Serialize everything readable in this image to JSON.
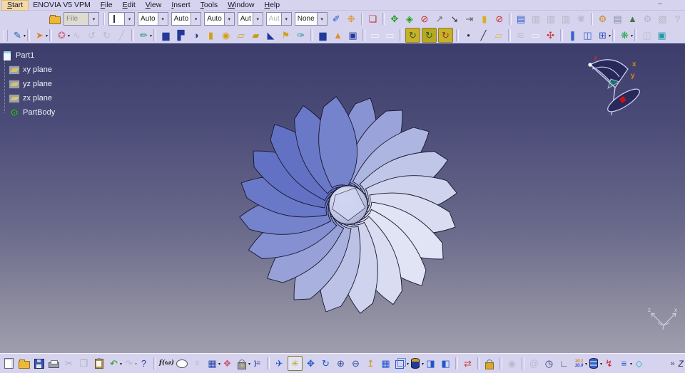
{
  "menu": {
    "items": [
      {
        "label": "Start",
        "ul": true,
        "hl": true
      },
      {
        "label": "ENOVIA V5 VPM",
        "ul": false
      },
      {
        "label": "File",
        "ul": true
      },
      {
        "label": "Edit",
        "ul": true
      },
      {
        "label": "View",
        "ul": true
      },
      {
        "label": "Insert",
        "ul": true
      },
      {
        "label": "Tools",
        "ul": true
      },
      {
        "label": "Window",
        "ul": true
      },
      {
        "label": "Help",
        "ul": true
      }
    ],
    "minimize_glyph": "–"
  },
  "filter_toolbar": {
    "file_combo": {
      "value": "File",
      "disabled": true
    },
    "swatch_color": "#1e8a1e",
    "combos": [
      {
        "value": "Auto"
      },
      {
        "value": "Auto"
      },
      {
        "value": "Auto"
      },
      {
        "value": "Aut",
        "narrow": true
      },
      {
        "value": "Aut",
        "narrow": true,
        "lite": true
      },
      {
        "value": "None"
      }
    ]
  },
  "toolbar2_icons": [
    {
      "n": "open-folder-icon",
      "s": "folder"
    },
    {
      "t": "combo-file"
    },
    {
      "t": "sep"
    },
    {
      "t": "combo-swatch"
    },
    {
      "t": "combos"
    },
    {
      "n": "painter-icon",
      "g": "✐",
      "c": "#2a55c8"
    },
    {
      "n": "paint-ball-icon",
      "g": "❉",
      "c": "#e09020"
    },
    {
      "t": "sep"
    },
    {
      "n": "image-capture-icon",
      "g": "❏",
      "c": "#c03333"
    },
    {
      "t": "sep"
    },
    {
      "n": "move-element-icon",
      "g": "✥",
      "c": "#1f9f1f"
    },
    {
      "n": "snap-element-icon",
      "g": "◈",
      "c": "#1f9f1f"
    },
    {
      "n": "axis-lock-icon",
      "g": "⊘",
      "c": "#cc2222"
    },
    {
      "n": "ray-pointer-icon",
      "g": "↗",
      "c": "#707070"
    },
    {
      "n": "target-arrow-icon",
      "g": "↘",
      "c": "#303030"
    },
    {
      "n": "step-snap-icon",
      "g": "⇥",
      "c": "#606060"
    },
    {
      "n": "ruler-cursor-icon",
      "g": "▮",
      "c": "#d8b020"
    },
    {
      "n": "no-magnify-icon",
      "g": "⊘",
      "c": "#cc2222"
    },
    {
      "t": "sep"
    },
    {
      "n": "form-sheet-icon",
      "g": "▤",
      "c": "#2a55c8"
    },
    {
      "n": "vpm-table-icon-1",
      "g": "▥",
      "c": "#888",
      "d": 1
    },
    {
      "n": "vpm-table-icon-2",
      "g": "▥",
      "c": "#888",
      "d": 1
    },
    {
      "n": "vpm-table-icon-3",
      "g": "▥",
      "c": "#888",
      "d": 1
    },
    {
      "n": "vpm-flower-icon",
      "g": "❋",
      "c": "#888",
      "d": 1
    },
    {
      "t": "sep"
    },
    {
      "n": "gear-transfer-icon",
      "g": "⚙",
      "c": "#cc8820"
    },
    {
      "n": "sheet-icon",
      "g": "▤",
      "c": "#8890a8"
    },
    {
      "n": "image-mountain-icon",
      "g": "▲",
      "c": "#447744"
    },
    {
      "n": "gear-gray-icon",
      "g": "⚙",
      "c": "#888",
      "d": 1
    },
    {
      "n": "transfer-gray-icon",
      "g": "▧",
      "c": "#888",
      "d": 1
    },
    {
      "n": "help-gray-icon",
      "g": "?",
      "c": "#888",
      "d": 1
    }
  ],
  "toolbar3_icons": [
    {
      "n": "sketcher-icon",
      "g": "✎",
      "c": "#2266aa",
      "dd": 1
    },
    {
      "t": "sep"
    },
    {
      "n": "select-cursor-icon",
      "g": "➤",
      "c": "#e08030",
      "dd": 1
    },
    {
      "t": "sep"
    },
    {
      "n": "people-icon",
      "g": "✪",
      "c": "#cc7788",
      "dd": 1
    },
    {
      "n": "wave-gray-icon",
      "g": "∿",
      "c": "#999",
      "d": 1
    },
    {
      "n": "rotate-left-gray-icon",
      "g": "↺",
      "c": "#999",
      "d": 1
    },
    {
      "n": "rotate-right-gray-icon",
      "g": "↻",
      "c": "#999",
      "d": 1
    },
    {
      "n": "slash-gray-icon",
      "g": "╱",
      "c": "#999",
      "d": 1
    },
    {
      "t": "sep"
    },
    {
      "n": "workbench-icon",
      "g": "✏",
      "c": "#1f8f8f",
      "dd": 1
    },
    {
      "t": "sep"
    },
    {
      "n": "pad-icon",
      "g": "▆",
      "c": "#22399a"
    },
    {
      "n": "pocket-icon",
      "g": "▛",
      "c": "#22399a"
    },
    {
      "n": "shaft-icon",
      "g": "◑",
      "c": "#22399a"
    },
    {
      "n": "groove-icon",
      "g": "▮",
      "c": "#d4a017"
    },
    {
      "n": "hole-icon",
      "g": "◉",
      "c": "#d4a017"
    },
    {
      "n": "rib-icon",
      "g": "▱",
      "c": "#d4a017"
    },
    {
      "n": "slot-icon",
      "g": "▰",
      "c": "#c89a10"
    },
    {
      "n": "stiffener-icon",
      "g": "◣",
      "c": "#22399a"
    },
    {
      "n": "loft-icon",
      "g": "⚑",
      "c": "#d4a017"
    },
    {
      "n": "surface-pencil-icon",
      "g": "✑",
      "c": "#1f8f8f"
    },
    {
      "t": "sep"
    },
    {
      "n": "pad-second-icon",
      "g": "▆",
      "c": "#22399a"
    },
    {
      "n": "bell-icon",
      "g": "▲",
      "c": "#e09020"
    },
    {
      "n": "block-icon",
      "g": "▣",
      "c": "#22399a"
    },
    {
      "t": "sep"
    },
    {
      "n": "constraint-oval-icon-1",
      "g": "▭",
      "c": "#f4f4fc"
    },
    {
      "n": "constraint-oval-icon-2",
      "g": "▭",
      "c": "#f4f4fc"
    },
    {
      "t": "sep"
    },
    {
      "n": "boolean-assemble-icon",
      "g": "↻",
      "c": "#226622",
      "bg": "#c8b028"
    },
    {
      "n": "boolean-add-icon",
      "g": "↻",
      "c": "#226622",
      "bg": "#b8a820"
    },
    {
      "n": "boolean-remove-icon",
      "g": "↻",
      "c": "#884422",
      "bg": "#c8b028"
    },
    {
      "t": "sep"
    },
    {
      "n": "point-icon",
      "g": "•",
      "c": "#333344"
    },
    {
      "n": "line-icon",
      "g": "╱",
      "c": "#333344"
    },
    {
      "n": "plane-icon",
      "g": "▱",
      "c": "#d8c040"
    },
    {
      "t": "sep"
    },
    {
      "n": "surface-gray-icon",
      "g": "≋",
      "c": "#999",
      "d": 1
    },
    {
      "n": "join-icon",
      "g": "▭",
      "c": "#f0f0f8"
    },
    {
      "n": "stamp-icon",
      "g": "✣",
      "c": "#cc3333"
    },
    {
      "t": "sep"
    },
    {
      "n": "catalog-icon",
      "g": "❚",
      "c": "#3366cc"
    },
    {
      "n": "mannequin-icon",
      "g": "◫",
      "c": "#3366cc"
    },
    {
      "n": "pattern-grid-icon",
      "g": "⊞",
      "c": "#3355bb",
      "dd": 1
    },
    {
      "t": "sep"
    },
    {
      "n": "axis-system-icon",
      "g": "❋",
      "c": "#22aa44",
      "dd": 1
    },
    {
      "t": "sep"
    },
    {
      "n": "measure-gray-icon",
      "g": "◫",
      "c": "#999",
      "d": 1
    },
    {
      "n": "bounding-box-icon",
      "g": "▣",
      "c": "#2299aa"
    }
  ],
  "bottom_icons": [
    {
      "n": "new-icon",
      "s": "page"
    },
    {
      "n": "open-icon",
      "s": "folder"
    },
    {
      "n": "save-icon",
      "s": "floppy"
    },
    {
      "n": "print-icon",
      "s": "printer"
    },
    {
      "n": "cut-icon",
      "g": "✂",
      "c": "#777",
      "d": 1
    },
    {
      "n": "copy-icon",
      "g": "❐",
      "c": "#777",
      "d": 1
    },
    {
      "n": "paste-icon",
      "s": "clipboard"
    },
    {
      "n": "undo-icon",
      "g": "↶",
      "c": "#22991f",
      "dd": 1
    },
    {
      "n": "redo-icon",
      "g": "↷",
      "c": "#999",
      "d": 1,
      "dd": 1
    },
    {
      "n": "help-what-icon",
      "g": "?",
      "c": "#2244aa"
    },
    {
      "t": "sep"
    },
    {
      "n": "formula-icon",
      "g": "f(ω)",
      "c": "#222",
      "small": 1,
      "italic": 1
    },
    {
      "n": "comment-bubble-icon",
      "s": "bubble"
    },
    {
      "n": "tiny-gray-icon",
      "g": "8",
      "c": "#aaa",
      "d": 1,
      "small": 1
    },
    {
      "n": "design-table-icon",
      "g": "▦",
      "c": "#2244aa",
      "dd": 1
    },
    {
      "n": "product-structure-icon",
      "g": "❖",
      "c": "#cc5577"
    },
    {
      "n": "lock-icon",
      "s": "lock",
      "dd": 1
    },
    {
      "n": "relations-icon",
      "g": "}=",
      "c": "#2244aa",
      "small": 1
    },
    {
      "t": "sep"
    },
    {
      "n": "fly-mode-icon",
      "g": "✈",
      "c": "#2255cc"
    },
    {
      "n": "fit-all-icon",
      "g": "✳",
      "c": "#c8a020",
      "bg": "#e2e5f4"
    },
    {
      "n": "pan-icon",
      "g": "✥",
      "c": "#2255cc"
    },
    {
      "n": "rotate-view-icon",
      "g": "↻",
      "c": "#2255cc"
    },
    {
      "n": "zoom-in-icon",
      "g": "⊕",
      "c": "#2f4f9f"
    },
    {
      "n": "zoom-out-icon",
      "g": "⊖",
      "c": "#2f4f9f"
    },
    {
      "n": "normal-view-icon",
      "g": "↥",
      "c": "#cc9922"
    },
    {
      "n": "multi-view-icon",
      "g": "▦",
      "c": "#2255cc"
    },
    {
      "n": "iso-view-icon",
      "s": "cube",
      "dd": 1
    },
    {
      "n": "shading-icon",
      "s": "cyl",
      "dd": 1
    },
    {
      "n": "hide-show-icon",
      "g": "◨",
      "c": "#2255cc"
    },
    {
      "n": "swap-visible-icon",
      "g": "◧",
      "c": "#2255cc"
    },
    {
      "t": "sep"
    },
    {
      "n": "swap-space-icon",
      "g": "⇄",
      "c": "#cc4433"
    },
    {
      "t": "sep"
    },
    {
      "n": "data-lock-icon",
      "s": "lockgold"
    },
    {
      "t": "sep"
    },
    {
      "n": "camera-icon",
      "g": "◉",
      "c": "#999",
      "d": 1
    },
    {
      "t": "sep"
    },
    {
      "n": "spiral-gray-icon",
      "g": "@",
      "c": "#999",
      "d": 1
    },
    {
      "n": "knowledge-clock-icon",
      "g": "◷",
      "c": "#223366"
    },
    {
      "n": "axes-corner-icon",
      "g": "∟",
      "c": "#445566"
    },
    {
      "n": "measure-between-icon",
      "s": "nums",
      "dd": 1
    },
    {
      "n": "mass-properties-icon",
      "s": "cylblue",
      "dd": 1
    },
    {
      "n": "spark-icon",
      "g": "↯",
      "c": "#cc2222"
    },
    {
      "n": "list-icon",
      "g": "≡",
      "c": "#2255cc",
      "dd": 1
    },
    {
      "n": "free-diamond-icon",
      "g": "◇",
      "c": "#22aacc"
    }
  ],
  "measure_icon_text": {
    "top": "10.1",
    "bottom": "10.0"
  },
  "bottom_right": {
    "overflow_glyph": "»",
    "partial_icon_glyph": "Z"
  },
  "tree": {
    "root": {
      "label": "Part1",
      "icon": "doc"
    },
    "items": [
      {
        "label": "xy plane",
        "icon": "plane"
      },
      {
        "label": "yz plane",
        "icon": "plane"
      },
      {
        "label": "zx plane",
        "icon": "plane"
      },
      {
        "label": "PartBody",
        "icon": "gear"
      }
    ]
  },
  "compass": {
    "z": "z",
    "x": "x",
    "y": "y",
    "label_color_z": "#c03030",
    "label_color_xy": "#d88818",
    "outline_color": "#ccccee",
    "fill_color": "#28285a",
    "wedge_color": "#1f6f6f",
    "square_color": "#cc1111"
  },
  "triad": {
    "z": "z",
    "x": "x",
    "color": "#d0d0e2"
  },
  "model": {
    "kind": "impeller-fan",
    "blade_count": 20,
    "splitter_count": 20,
    "body_hue": 231,
    "edge_color": "#15152a",
    "hub_light": "#eef0fa",
    "hub_dark": "#a4aad2"
  },
  "viewport_gradient": {
    "top": "#3d3d6b",
    "bottom": "#9f9eae"
  }
}
